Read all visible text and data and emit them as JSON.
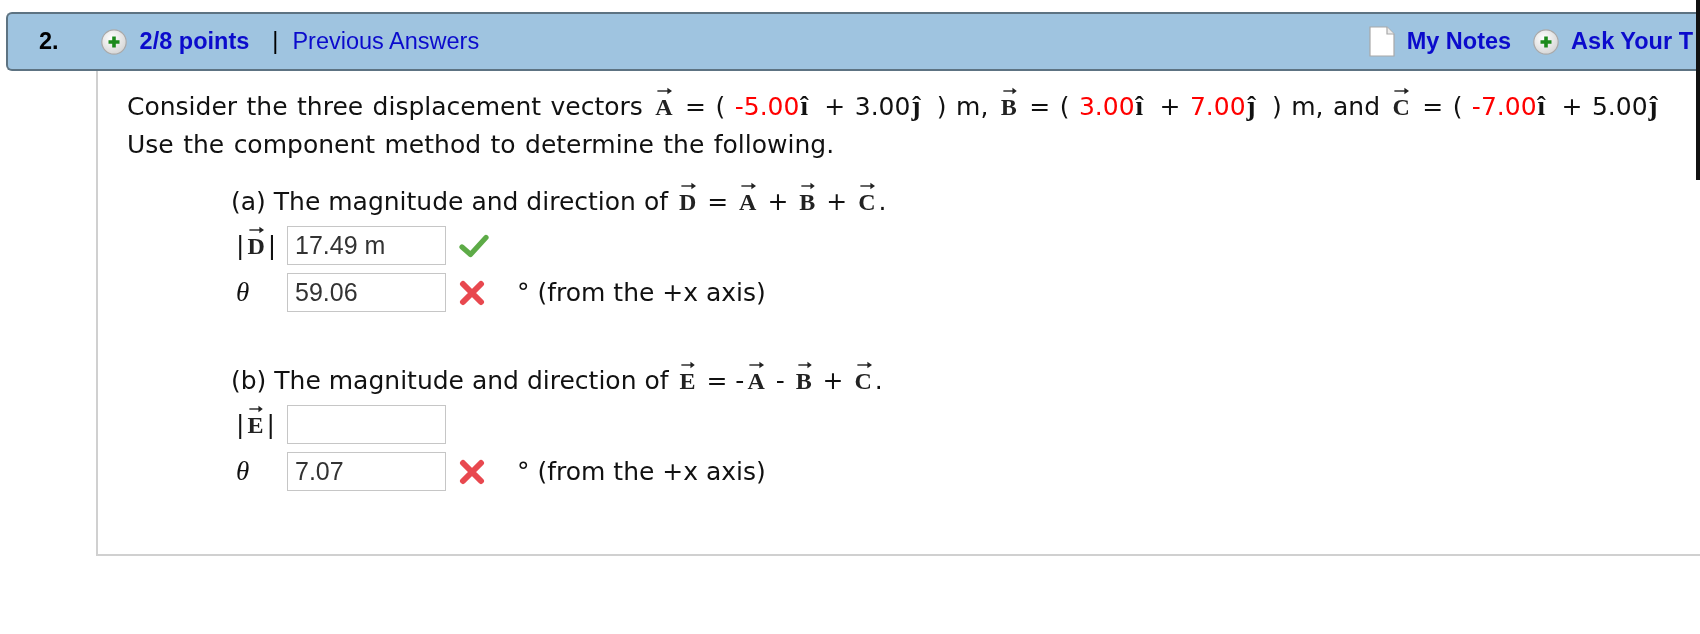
{
  "header": {
    "number": "2.",
    "score": "2/8 points",
    "separator": "|",
    "history_link": "Previous Answers",
    "notes_link": "My Notes",
    "ask_link": "Ask Your T"
  },
  "question": {
    "lines": [
      [
        {
          "kind": "text",
          "text": "Consider the three displacement vectors "
        },
        {
          "kind": "vector",
          "text": "A"
        },
        {
          "kind": "text",
          "text": " = ( "
        },
        {
          "kind": "value",
          "text": "-5.00"
        },
        {
          "kind": "unit",
          "text": "î"
        },
        {
          "kind": "text",
          "text": " + 3.00"
        },
        {
          "kind": "unit",
          "text": "ĵ"
        },
        {
          "kind": "text",
          "text": " ) m, "
        },
        {
          "kind": "vector",
          "text": "B"
        },
        {
          "kind": "text",
          "text": " = ( "
        },
        {
          "kind": "value",
          "text": "3.00"
        },
        {
          "kind": "unit",
          "text": "î"
        },
        {
          "kind": "text",
          "text": " + "
        },
        {
          "kind": "value",
          "text": "7.00"
        },
        {
          "kind": "unit",
          "text": "ĵ"
        },
        {
          "kind": "text",
          "text": " ) m, and "
        },
        {
          "kind": "vector",
          "text": "C"
        },
        {
          "kind": "text",
          "text": " = ( "
        },
        {
          "kind": "value",
          "text": "-7.00"
        },
        {
          "kind": "unit",
          "text": "î"
        },
        {
          "kind": "text",
          "text": " + 5.00"
        },
        {
          "kind": "unit",
          "text": "ĵ"
        }
      ],
      [
        {
          "kind": "text",
          "text": "Use the component method to determine the following."
        }
      ]
    ]
  },
  "parts": [
    {
      "prompt": [
        {
          "kind": "text",
          "text": "(a) The magnitude and direction of "
        },
        {
          "kind": "vector",
          "text": "D"
        },
        {
          "kind": "text",
          "text": " = "
        },
        {
          "kind": "vector",
          "text": "A"
        },
        {
          "kind": "text",
          "text": " + "
        },
        {
          "kind": "vector",
          "text": "B"
        },
        {
          "kind": "text",
          "text": " + "
        },
        {
          "kind": "vector",
          "text": "C"
        },
        {
          "kind": "text",
          "text": "."
        }
      ],
      "answers": [
        {
          "label": [
            {
              "kind": "text",
              "text": "|"
            },
            {
              "kind": "vector",
              "text": "D"
            },
            {
              "kind": "text",
              "text": "|"
            }
          ],
          "value": "17.49 m",
          "correct": true
        },
        {
          "label": [
            {
              "kind": "variable",
              "text": "θ"
            }
          ],
          "value": "59.06",
          "correct": false,
          "suffix": "° (from the +x axis)"
        }
      ]
    },
    {
      "prompt": [
        {
          "kind": "text",
          "text": "(b) The magnitude and direction of "
        },
        {
          "kind": "vector",
          "text": "E"
        },
        {
          "kind": "text",
          "text": " = -"
        },
        {
          "kind": "vector",
          "text": "A"
        },
        {
          "kind": "text",
          "text": " - "
        },
        {
          "kind": "vector",
          "text": "B"
        },
        {
          "kind": "text",
          "text": " + "
        },
        {
          "kind": "vector",
          "text": "C"
        },
        {
          "kind": "text",
          "text": "."
        }
      ],
      "answers": [
        {
          "label": [
            {
              "kind": "text",
              "text": "|"
            },
            {
              "kind": "vector",
              "text": "E"
            },
            {
              "kind": "text",
              "text": "|"
            }
          ]
        },
        {
          "label": [
            {
              "kind": "variable",
              "text": "θ"
            }
          ],
          "value": "7.07",
          "correct": false,
          "suffix": "° (from the +x axis)"
        }
      ]
    }
  ]
}
